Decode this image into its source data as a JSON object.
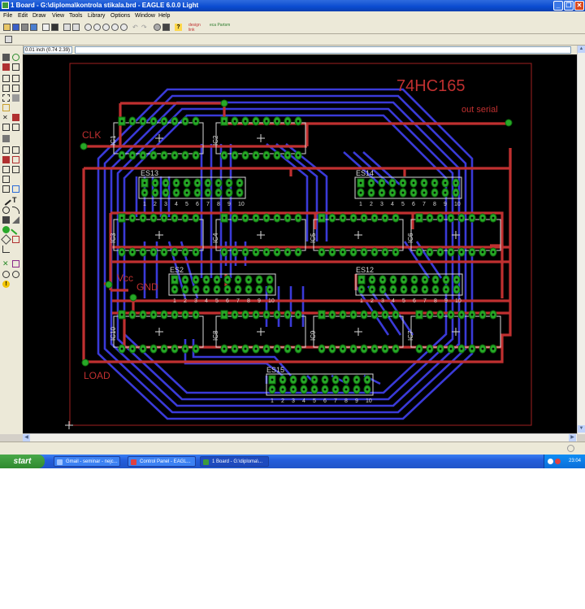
{
  "window": {
    "title": "1 Board - G:\\diploma\\kontrola stikala.brd - EAGLE 6.0.0 Light"
  },
  "menu": [
    "File",
    "Edit",
    "Draw",
    "View",
    "Tools",
    "Library",
    "Options",
    "Window",
    "Help"
  ],
  "toolbar": {
    "design_link_label": "design link",
    "eca_label": "eca Partsm"
  },
  "coord_display": "0.01 inch (0.74 2.39)",
  "board": {
    "labels": {
      "title": "74HC165",
      "out_serial": "out serial",
      "clk": "CLK",
      "vcc": "Vcc",
      "gnd": "GND",
      "load": "LOAD"
    },
    "connectors": [
      {
        "name": "ES13",
        "pins": [
          "1",
          "2",
          "3",
          "4",
          "5",
          "6",
          "7",
          "8",
          "9",
          "10"
        ]
      },
      {
        "name": "ES14",
        "pins": [
          "1",
          "2",
          "3",
          "4",
          "5",
          "6",
          "7",
          "8",
          "9",
          "10"
        ]
      },
      {
        "name": "ES2",
        "pins": [
          "1",
          "2",
          "3",
          "4",
          "5",
          "6",
          "7",
          "8",
          "9",
          "10"
        ]
      },
      {
        "name": "ES12",
        "pins": [
          "1",
          "2",
          "3",
          "4",
          "5",
          "6",
          "7",
          "8",
          "9",
          "10"
        ]
      },
      {
        "name": "ES15",
        "pins": [
          "1",
          "2",
          "3",
          "4",
          "5",
          "6",
          "7",
          "8",
          "9",
          "10"
        ]
      }
    ],
    "ics": [
      "IC1",
      "IC2",
      "IC3",
      "IC4",
      "IC5",
      "IC6",
      "IC7",
      "IC8",
      "IC9",
      "IC10"
    ]
  },
  "colors": {
    "top_layer": "#c03030",
    "bottom_layer": "#3a3ad8",
    "pad": "#27a827",
    "dimension": "#a02020",
    "background": "#000000"
  },
  "taskbar": {
    "start_label": "start",
    "tasks": [
      {
        "label": "Gmail - seminar - nejc..."
      },
      {
        "label": "Control Panel - EAGL..."
      },
      {
        "label": "1 Board - G:\\diploma\\..."
      }
    ],
    "clock": "23:04"
  }
}
